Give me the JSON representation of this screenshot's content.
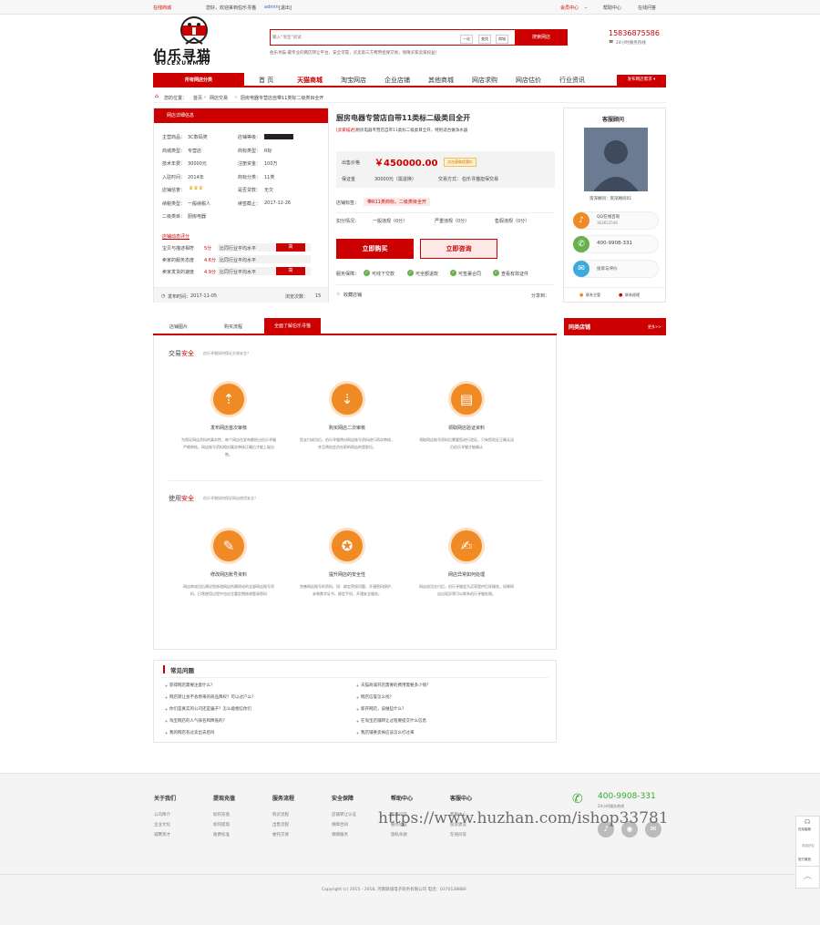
{
  "topbar": {
    "online_bid": "在线商城",
    "welcome": "您好，欢迎来到伯乐寻猫",
    "user": "admin",
    "logout": "[退出]",
    "member_center": "会员中心",
    "help_center": "帮助中心",
    "online_ask": "在线问答"
  },
  "logo": {
    "cn": "伯乐寻猫",
    "en": "BOLEXUNMAO"
  },
  "search": {
    "placeholder": "输入“淘宝”试试",
    "tabs": [
      "一站",
      "查找",
      "商城"
    ],
    "button": "搜索网店",
    "desc": "伯乐寻猫-最专业的网店转让平台，安全可靠，买卖第三方费用担保交易，保障买家卖家权益！"
  },
  "hotline": {
    "phone": "15836875586",
    "label": "24小时服务热线"
  },
  "nav": {
    "all_category": "所有网店分类",
    "items": [
      "首 页",
      "天猫商城",
      "淘宝网店",
      "企业店铺",
      "其他商城",
      "网店求购",
      "网店估价",
      "行业资讯"
    ],
    "publish": "发布网店需求"
  },
  "breadcrumb": {
    "label": "您的位置：",
    "path": [
      "首页",
      "网店交易",
      "厨房电器专营店自带11类标二级类目全开"
    ]
  },
  "detail_panel": {
    "title": "网店详细信息",
    "rows": [
      {
        "k": "主营商品：",
        "v": "3C数码类",
        "k2": "店铺等级：",
        "v2": ""
      },
      {
        "k": "商城类型：",
        "v": "专营店",
        "k2": "商标类型：",
        "v2": "R标"
      },
      {
        "k": "技术年费：",
        "v": "30000元",
        "k2": "注册资金：",
        "v2": "100万"
      },
      {
        "k": "入驻时间：",
        "v": "2014年",
        "k2": "商标分类：",
        "v2": "11类"
      },
      {
        "k": "店铺信誉：",
        "v": "",
        "k2": "是否贷款：",
        "v2": "无欠"
      },
      {
        "k": "纳税类型：",
        "v": "一般纳税人",
        "k2": "续签截止：",
        "v2": "2017-12-26"
      },
      {
        "k": "二级类目：",
        "v": "厨房电器",
        "k2": "",
        "v2": ""
      }
    ],
    "rating_title": "店铺动态评分",
    "ratings": [
      {
        "k": "宝贝与描述相符",
        "score": "5分",
        "cmp": "比同行业平均水平",
        "tag": "高"
      },
      {
        "k": "卖家的服务态度",
        "score": "4.6分",
        "cmp": "比同行业平均水平",
        "tag": ""
      },
      {
        "k": "卖家发货的速度",
        "score": "4.9分",
        "cmp": "比同行业平均水平",
        "tag": "高"
      }
    ],
    "publish_time_label": "发布时间：",
    "publish_time": "2017-11-05",
    "view_label": "浏览次数：",
    "views": "15"
  },
  "main": {
    "title": "厨房电器专营店自带11类标二级类目全开",
    "seller_desc_tag": "[卖家描述]",
    "seller_desc": "厨房电器专营店自带11类标二级类目全开，特别适合做净水器",
    "price_label": "出售价格",
    "price": "￥450000.00",
    "price_tip": "点击获取优惠价",
    "deposit_label": "保证金",
    "deposit": "30000元（需退换）",
    "trade_label": "交易方式：",
    "trade": "伯乐寻猫担保交易",
    "tags_label": "店铺标签：",
    "tags": "带R11类商标，二级类目全开",
    "penalty_label": "扣分情况：",
    "penalties": [
      "一般违规（0分）",
      "严重违规（0分）",
      "售假违规（0分）"
    ],
    "buy_button": "立即购买",
    "consult_button": "立即咨询",
    "guarantee_label": "服务保障：",
    "guarantees": [
      "可线下交款",
      "可全额退款",
      "可签署合同",
      "查看有效证件"
    ],
    "favorite": "收藏店铺",
    "share": "分享到："
  },
  "service": {
    "title": "客服顾问",
    "agent": "资深顾问：资深顾问01",
    "qq_label": "QQ在线咨询",
    "qq": "363652546",
    "phone": "400-9908-331",
    "complain": "投诉与评价",
    "link1": "联系主管",
    "link2": "联系经理"
  },
  "tabs": [
    "店铺图片",
    "购买流程",
    "全面了解伯乐寻猫"
  ],
  "similar": {
    "title": "同类店铺",
    "more": "更多>>"
  },
  "trade_safety": {
    "title_a": "交易",
    "title_b": "安全",
    "subtitle": "伯乐寻猫如何保证交易安全？",
    "items": [
      {
        "title": "发布网店首次审核",
        "desc": "为保证网店资料的真实性，每个网店在发布都经过伯乐寻猫严格审核，网店账号资料相对真实审核正确后才能上架出售。"
      },
      {
        "title": "购买网店二次审核",
        "desc": "您支付成功后，伯乐寻猫将对网店账号资料进行再次审核，并且将由会员在职的网店的是那位。"
      },
      {
        "title": "领取网店验证资料",
        "desc": "领取网店账号资料后需要您进行验证，只有您验证正确无误后伯乐寻猫才能确认"
      }
    ]
  },
  "use_safety": {
    "title_a": "使用",
    "title_b": "安全",
    "subtitle": "伯乐寻猫如何保证网店使用安全？",
    "items": [
      {
        "title": "修改网店账号资料",
        "desc": "网店转成功后建议您修改网店所属网站的全部网店账号资料，日常使用过程中也应注重定期修改登录密码"
      },
      {
        "title": "提升网店的安全性",
        "desc": "完善网店账号的资料，如：绑定密保问题、开通密码保护、安装数字证书、绑定手机、开通安全服务。"
      },
      {
        "title": "网店异常如何处理",
        "desc": "网店成功交付后，伯乐寻猫会为买家提供后续服务，如果网店出现异常可以联系伯乐寻猫处理。"
      }
    ]
  },
  "faq": {
    "title": "常见问题",
    "left": [
      "获得网店需要注意什么？",
      "网店转让会不会原来的商品降权？可以过户么？",
      "你们是真实的公司还是骗子？怎么能相信你们",
      "淘宝网店的人气排名和降低的？",
      "我的网店有过卖出去后吗"
    ],
    "right": [
      "天猫商城开店需要的费用需要多少钱？",
      "网店信誉怎么找？",
      "新开网店，该做些什么？",
      "在淘宝店铺转让过程要提交什么信息",
      "我店铺要卖掉应该怎么打过来"
    ]
  },
  "footer": {
    "columns": [
      {
        "title": "关于我们",
        "links": [
          "公司简介",
          "企业文化",
          "诚聘英才"
        ]
      },
      {
        "title": "提现充值",
        "links": [
          "如何充值",
          "如何提现",
          "收费标准"
        ]
      },
      {
        "title": "服务流程",
        "links": [
          "购买流程",
          "出售流程",
          "委托交易"
        ]
      },
      {
        "title": "安全保障",
        "links": [
          "店铺转让认证",
          "保障合同",
          "保障服务"
        ]
      },
      {
        "title": "帮助中心",
        "links": [
          "新手问答",
          "服务协议",
          "隐私条款"
        ]
      },
      {
        "title": "客服中心",
        "links": [
          "客服中心",
          "投诉建议",
          "在线问答"
        ]
      }
    ],
    "hotline": "400-9908-331",
    "hotline_label": "24小时服务热线",
    "copyright": "Copyright (c) 2015 - 2018, 河南联诚电子商务有限公司 电话：0370138880",
    "watermark": "https://www.huzhan.com/ishop33781"
  },
  "float_bar": [
    "在线客服",
    "添加好友",
    "官方微信"
  ]
}
